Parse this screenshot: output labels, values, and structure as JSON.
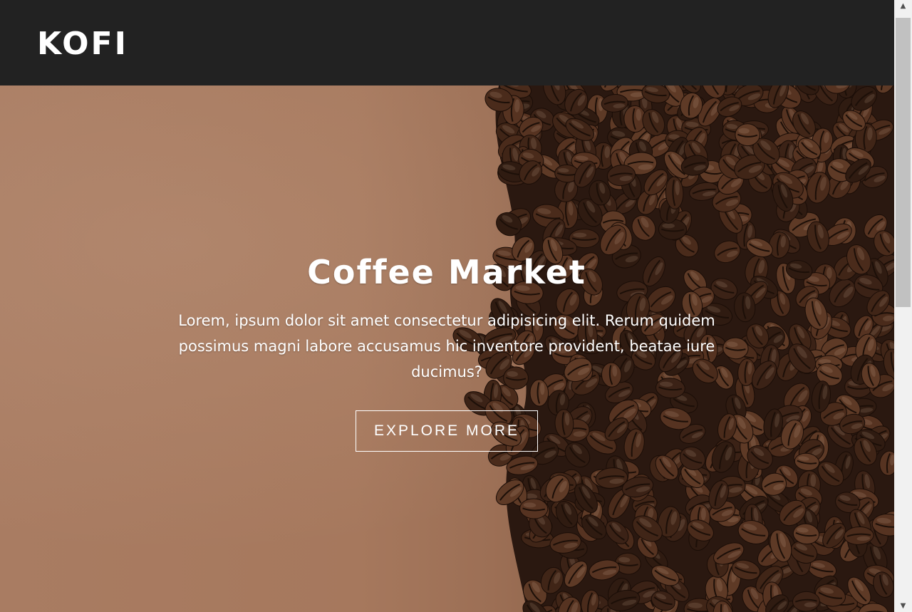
{
  "header": {
    "logo": "KOFI"
  },
  "hero": {
    "title": "Coffee Market",
    "description": "Lorem, ipsum dolor sit amet consectetur adipisicing elit. Rerum quidem possimus magni labore accusamus hic inventore provident, beatae iure ducimus?",
    "button_label": "EXPLORE MORE",
    "background_image": "coffee-beans-on-brown-paper"
  },
  "colors": {
    "navbar_bg": "#222222",
    "paper": "#a97b60",
    "text": "#ffffff"
  },
  "scrollbar": {
    "up_icon": "chevron-up-icon",
    "down_icon": "chevron-down-icon"
  }
}
